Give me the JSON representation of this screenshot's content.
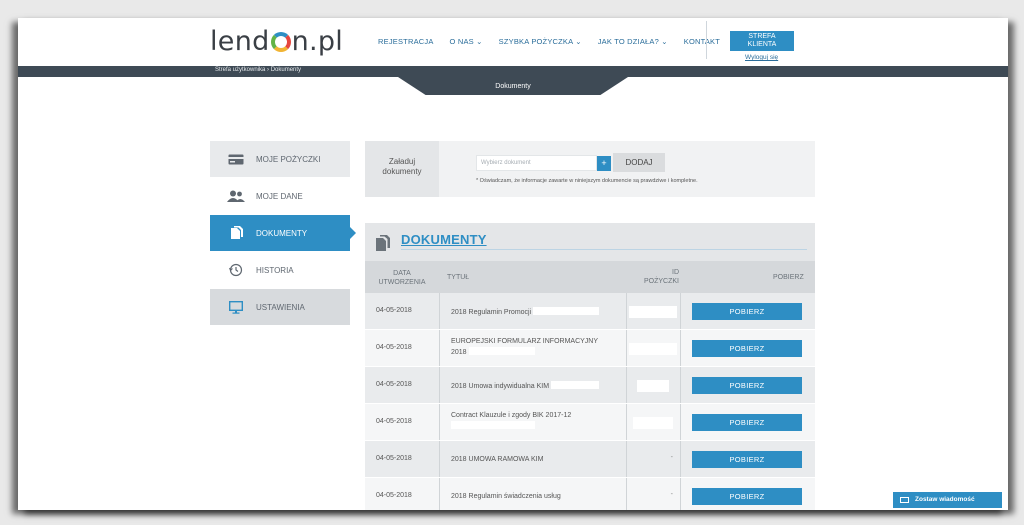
{
  "brand": {
    "logo_left": "lend",
    "logo_right": "n.pl"
  },
  "nav": [
    {
      "label": "REJESTRACJA"
    },
    {
      "label": "O NAS ⌄"
    },
    {
      "label": "SZYBKA POŻYCZKA ⌄"
    },
    {
      "label": "JAK TO DZIAŁA? ⌄"
    },
    {
      "label": "KONTAKT"
    }
  ],
  "client": {
    "line1": "STREFA",
    "line2": "KLIENTA",
    "logout": "Wyloguj się"
  },
  "breadcrumb": "Strefa użytkownika  ›  Dokumenty",
  "page_tab": "Dokumenty",
  "sidebar": {
    "items": [
      {
        "label": "MOJE POŻYCZKI",
        "icon": "card-icon"
      },
      {
        "label": "MOJE DANE",
        "icon": "users-icon"
      },
      {
        "label": "DOKUMENTY",
        "icon": "documents-icon"
      },
      {
        "label": "HISTORIA",
        "icon": "history-icon"
      },
      {
        "label": "USTAWIENIA",
        "icon": "monitor-icon"
      }
    ]
  },
  "upload": {
    "label_line1": "Załaduj",
    "label_line2": "dokumenty",
    "placeholder": "Wybierz dokument",
    "plus": "+",
    "add": "DODAJ",
    "note": "* Oświadczam, że informacje zawarte w niniejszym dokumencie są prawdziwe i kompletne."
  },
  "docs": {
    "title": "DOKUMENTY",
    "headers": {
      "date_line1": "DATA",
      "date_line2": "UTWORZENIA",
      "title": "TYTUŁ",
      "id_line1": "ID",
      "id_line2": "POŻYCZKI",
      "download": "POBIERZ"
    },
    "rows": [
      {
        "date": "04-05-2018",
        "title": "2018 Regulamin Promocji",
        "title2": "",
        "id": "",
        "button": "POBIERZ"
      },
      {
        "date": "04-05-2018",
        "title": "EUROPEJSKI FORMULARZ INFORMACYJNY",
        "title2": "2018",
        "id": "",
        "button": "POBIERZ"
      },
      {
        "date": "04-05-2018",
        "title": "2018 Umowa indywidualna KIM",
        "title2": "",
        "id": "",
        "button": "POBIERZ"
      },
      {
        "date": "04-05-2018",
        "title": "Contract Klauzule i zgody BIK 2017-12",
        "title2": "",
        "id": "",
        "button": "POBIERZ"
      },
      {
        "date": "04-05-2018",
        "title": "2018 UMOWA RAMOWA KIM",
        "title2": "",
        "id": "-",
        "button": "POBIERZ"
      },
      {
        "date": "04-05-2018",
        "title": "2018 Regulamin świadczenia usług",
        "title2": "",
        "id": "-",
        "button": "POBIERZ"
      }
    ]
  },
  "chat": {
    "label": "Zostaw wiadomość"
  },
  "colors": {
    "accent": "#2e8ec4",
    "dark_bar": "#3e4a55"
  }
}
